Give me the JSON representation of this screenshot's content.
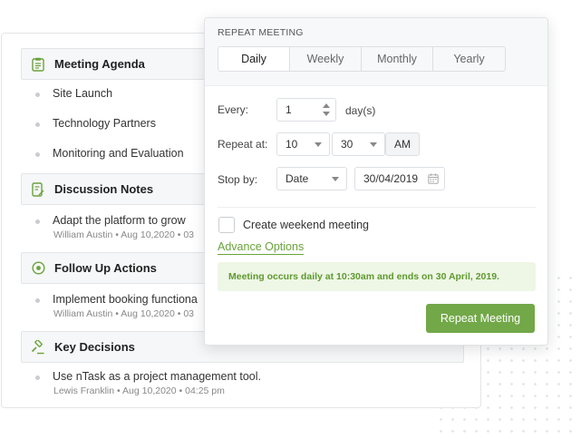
{
  "agenda": {
    "sections": [
      {
        "title": "Meeting Agenda",
        "icon": "clipboard-icon"
      },
      {
        "title": "Discussion Notes",
        "icon": "edit-note-icon"
      },
      {
        "title": "Follow Up Actions",
        "icon": "target-icon"
      },
      {
        "title": "Key Decisions",
        "icon": "gavel-icon"
      }
    ],
    "agenda_items": [
      "Site Launch",
      "Technology Partners",
      "Monitoring and Evaluation"
    ],
    "discussion": {
      "text": "Adapt the platform to grow",
      "meta": "William Austin • Aug 10,2020 • 03"
    },
    "followup": {
      "text": "Implement booking functiona",
      "meta": "William Austin • Aug 10,2020 • 03"
    },
    "decision": {
      "text": "Use nTask as a project management tool.",
      "meta": "Lewis Franklin • Aug 10,2020 • 04:25 pm"
    }
  },
  "repeat": {
    "title": "REPEAT MEETING",
    "tabs": [
      "Daily",
      "Weekly",
      "Monthly",
      "Yearly"
    ],
    "active_tab": "Daily",
    "every_label": "Every:",
    "every_value": "1",
    "every_unit": "day(s)",
    "repeat_at_label": "Repeat at:",
    "hour": "10",
    "minute": "30",
    "ampm": "AM",
    "stop_by_label": "Stop by:",
    "stop_by_type": "Date",
    "stop_date": "30/04/2019",
    "weekend_label": "Create weekend meeting",
    "weekend_checked": false,
    "advance_label": "Advance Options",
    "notice": "Meeting occurs daily at 10:30am and ends on 30 April, 2019.",
    "button_label": "Repeat Meeting"
  },
  "colors": {
    "accent": "#72a848",
    "accent_text": "#6aa23c",
    "notice_bg": "#eef6e6",
    "section_bg": "#f6f7f8"
  }
}
